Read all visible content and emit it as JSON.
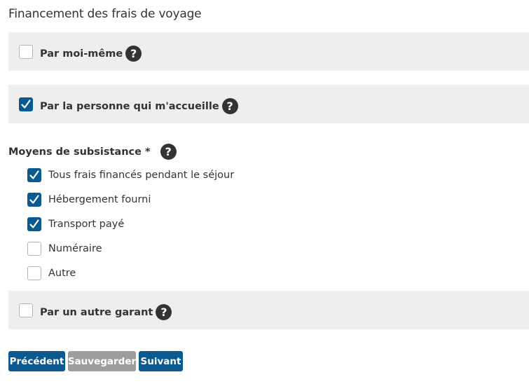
{
  "page": {
    "title": "Financement des frais de voyage"
  },
  "panels": [
    {
      "label": "Par moi-même",
      "checked": false
    },
    {
      "label": "Par la personne qui m'accueille",
      "checked": true
    },
    {
      "label": "Par un autre garant",
      "checked": false
    }
  ],
  "subsistence": {
    "label": "Moyens de subsistance *",
    "options": [
      {
        "label": "Tous frais financés pendant le séjour",
        "checked": true
      },
      {
        "label": "Hébergement fourni",
        "checked": true
      },
      {
        "label": "Transport payé",
        "checked": true
      },
      {
        "label": "Numéraire",
        "checked": false
      },
      {
        "label": "Autre",
        "checked": false
      }
    ]
  },
  "help_glyph": "?",
  "buttons": {
    "previous": "Précédent",
    "save": "Sauvegarder",
    "next": "Suivant"
  },
  "colors": {
    "accent": "#0b5a8f",
    "panel_bg": "#eeeeee",
    "disabled_button": "#9e9e9e",
    "text": "#333333"
  },
  "icons": {
    "help": "question-circle-icon",
    "check": "checkmark-icon"
  }
}
